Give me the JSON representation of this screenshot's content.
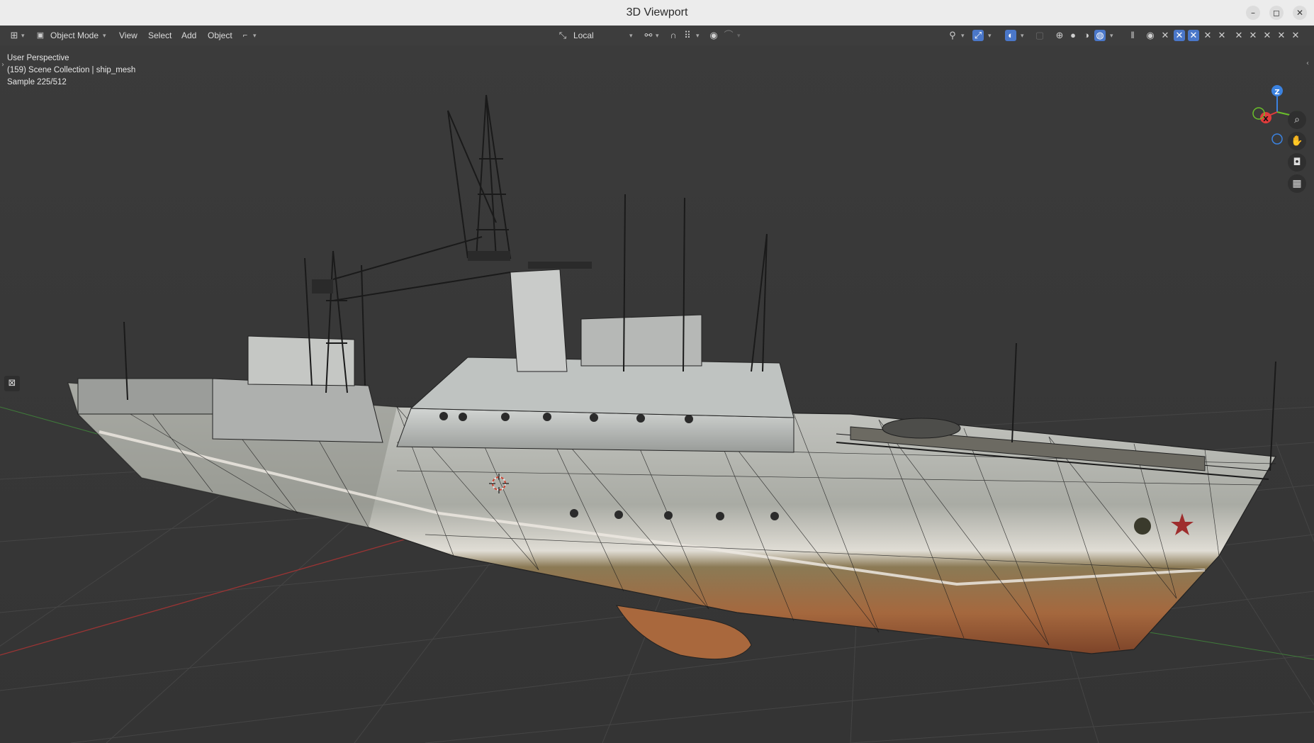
{
  "window": {
    "title": "3D Viewport",
    "minimize_glyph": "–",
    "restore_glyph": "◻",
    "close_glyph": "✕"
  },
  "header": {
    "editor_type_icon": "view3d-icon",
    "mode": {
      "label": "Object Mode",
      "icon": "object-mode-icon"
    },
    "menus": [
      "View",
      "Select",
      "Add",
      "Object"
    ],
    "orientation": {
      "label": "Local",
      "icon": "transform-orientation-icon"
    },
    "shading_active": "rendered",
    "accent": "#4a77c9"
  },
  "viewport": {
    "overlay_lines": [
      "User Perspective",
      "(159) Scene Collection | ship_mesh",
      "Sample 225/512"
    ],
    "gizmo": {
      "x": "X",
      "y": "Y",
      "z": "Z",
      "colors": {
        "x": "#e23c3c",
        "y": "#6ac02a",
        "z": "#3b82e0"
      }
    },
    "nav_buttons": [
      "zoom-icon",
      "pan-hand-icon",
      "camera-view-icon",
      "ortho-grid-icon"
    ]
  }
}
